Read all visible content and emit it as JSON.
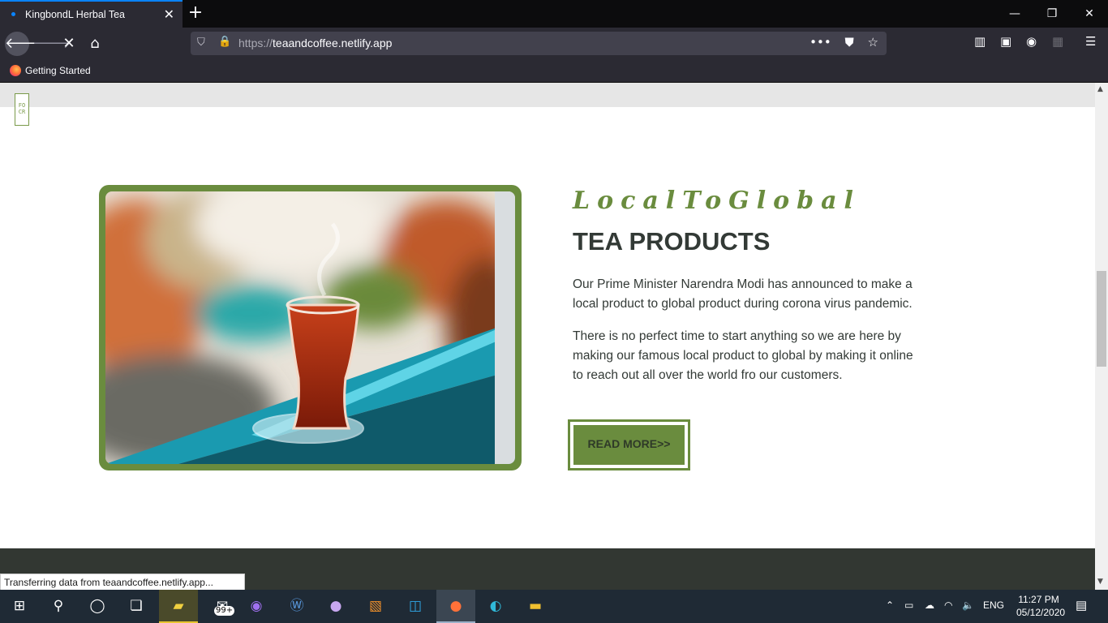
{
  "browser": {
    "tab_title": "KingbondL Herbal Tea",
    "tab_close": "✕",
    "new_tab": "+",
    "url_protocol": "https://",
    "url_domain": "teaandcoffee.netlify.app",
    "bookmark": "Getting Started",
    "status_text": "Transferring data from teaandcoffee.netlify.app...",
    "window": {
      "minimize": "—",
      "restore": "❐",
      "close": "✕"
    }
  },
  "page": {
    "logo_text": "FO CR",
    "tagline": "LocalToGlobal",
    "heading": "TEA PRODUCTS",
    "paragraph1": "Our Prime Minister Narendra Modi has announced to make a local product to global product during corona virus pandemic.",
    "paragraph2": "There is no perfect time to start anything so we are here by making our famous local product to global by making it online to reach out all over the world fro our customers.",
    "button": "READ MORE>>"
  },
  "taskbar": {
    "mail_badge": "99+",
    "lang": "ENG",
    "time": "11:27 PM",
    "date": "05/12/2020"
  },
  "colors": {
    "accent_green": "#6a8c3e",
    "text_dark": "#333a36",
    "footer_band": "#323732"
  }
}
